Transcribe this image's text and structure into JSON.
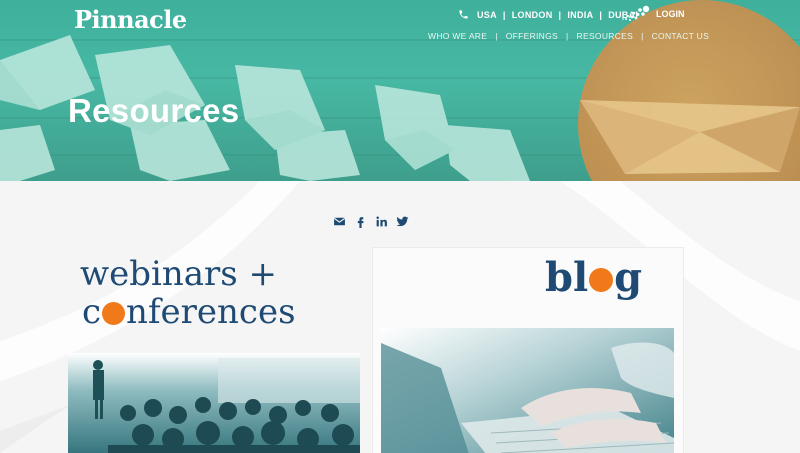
{
  "header": {
    "logo": "Pinnacle",
    "locations": [
      "USA",
      "LONDON",
      "INDIA",
      "DUBAI"
    ],
    "login_label": "LOGIN",
    "nav": [
      "WHO WE ARE",
      "OFFERINGS",
      "RESOURCES",
      "CONTACT US"
    ]
  },
  "hero": {
    "title": "Resources"
  },
  "social": {
    "icons": [
      "email-icon",
      "facebook-icon",
      "linkedin-icon",
      "twitter-icon"
    ]
  },
  "cards": {
    "webinars": {
      "line1": "webinars +",
      "line2_prefix": "c",
      "line2_rest": "nferences"
    },
    "blog": {
      "prefix": "bl",
      "suffix": "g"
    }
  },
  "colors": {
    "teal": "#47b8a3",
    "navy": "#1e4a73",
    "orange": "#f07a1a"
  }
}
